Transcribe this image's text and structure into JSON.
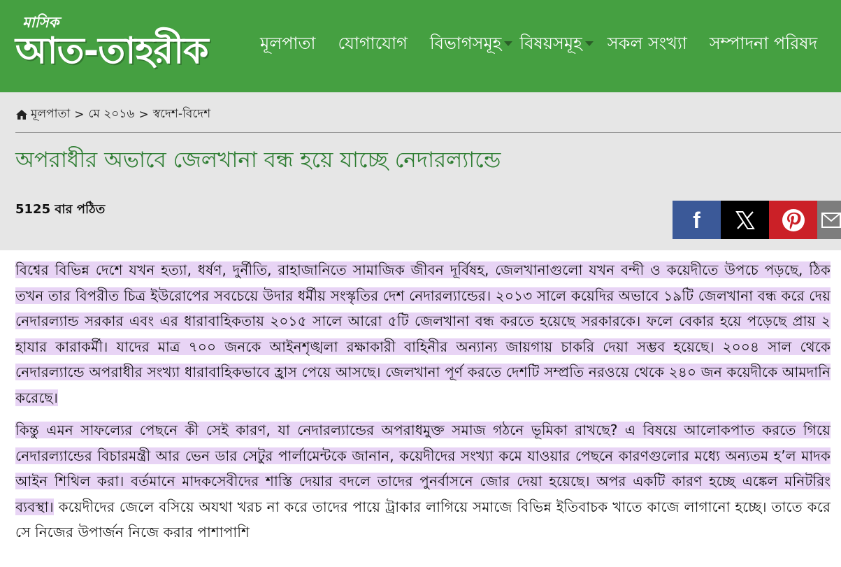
{
  "header": {
    "logo_small": "মাসিক",
    "logo_main": "আত-তাহরীক",
    "nav": [
      {
        "label": "মূলপাতা",
        "dropdown": false
      },
      {
        "label": "যোগাযোগ",
        "dropdown": false
      },
      {
        "label": "বিভাগসমূহ",
        "dropdown": true
      },
      {
        "label": "বিষয়সমূহ",
        "dropdown": true
      },
      {
        "label": "সকল সংখ্যা",
        "dropdown": false
      },
      {
        "label": "সম্পাদনা পরিষদ",
        "dropdown": false
      }
    ]
  },
  "breadcrumb": {
    "home": "মূলপাতা",
    "sep": ">",
    "issue": "মে ২০১৬",
    "section": "স্বদেশ-বিদেশ"
  },
  "article": {
    "title": "অপরাধীর অভাবে জেলখানা বন্ধ হয়ে যাচ্ছে নেদারল্যান্ডে",
    "views": "5125 বার পঠিত",
    "para1": "বিশ্বের বিভিন্ন দেশে যখন হত্যা, ধর্ষণ, দুর্নীতি, রাহাজানিতে সামাজিক জীবন দূর্বিষহ, জেলখানাগুলো যখন বন্দী ও কয়েদীতে উপচে পড়ছে, ঠিক তখন তার বিপরীত চিত্র ইউরোপের সবচেয়ে উদার ধর্মীয় সংস্কৃতির দেশ নেদারল্যান্ডের। ২০১৩ সালে কয়েদির অভাবে ১৯টি জেলখানা বন্ধ করে দেয় নেদারল্যান্ড সরকার এবং এর ধারাবাহিকতায় ২০১৫ সালে আরো ৫টি জেলখানা বন্ধ করতে হয়েছে সরকারকে। ফলে বেকার হয়ে পড়েছে প্রায় ২ হাযার কারাকর্মী। যাদের মাত্র ৭০০ জনকে আইনশৃঙ্খলা রক্ষাকারী বাহিনীর অন্যান্য জায়গায় চাকরি দেয়া সম্ভব হয়েছে। ২০০৪ সাল থেকে নেদারল্যান্ডে অপরাধীর সংখ্যা ধারাবাহিকভাবে হ্রাস পেয়ে আসছে। জেলখানা পূর্ণ করতে দেশটি সম্প্রতি নরওয়ে থেকে ২৪০ জন কয়েদীকে আমদানি করেছে।",
    "para2_highlight": "কিন্তু এমন সাফল্যের পেছনে কী সেই কারণ, যা নেদারল্যান্ডের অপরাধমুক্ত সমাজ গঠনে ভূমিকা রাখছে? এ বিষয়ে আলোকপাত করতে গিয়ে নেদারল্যান্ডের বিচারমন্ত্রী আর ভেন ডার সেটুর পার্লামেন্টকে জানান, কয়েদীদের সংখ্যা কমে যাওয়ার পেছনে কারণগুলোর মধ্যে অন্যতম হ’ল মাদক আইন শিথিল করা। বর্তমানে মাদকসেবীদের শাস্তি দেয়ার বদলে তাদের পুনর্বাসনে জোর দেয়া হয়েছে। অপর একটি কারণ হচ্ছে এঙ্কেল মনিটরিং ব্যবস্থা।",
    "para2_rest": " কয়েদীদের জেলে বসিয়ে অযথা খরচ না করে তাদের পায়ে ট্রাকার লাগিয়ে সমাজে বিভিন্ন ইতিবাচক খাতে কাজে লাগানো হচ্ছে। তাতে করে সে নিজের উপার্জন নিজে করার পাশাপাশি"
  },
  "share": {
    "facebook_icon": "f",
    "colors": {
      "facebook": "#3b5998",
      "x": "#000000",
      "pinterest": "#cb2027",
      "email": "#7d7d7d"
    }
  },
  "colors": {
    "header_bg": "#45a041",
    "title": "#2e7d32",
    "highlight": "#e8d4f5",
    "gray_bg": "#e6e6e6"
  }
}
